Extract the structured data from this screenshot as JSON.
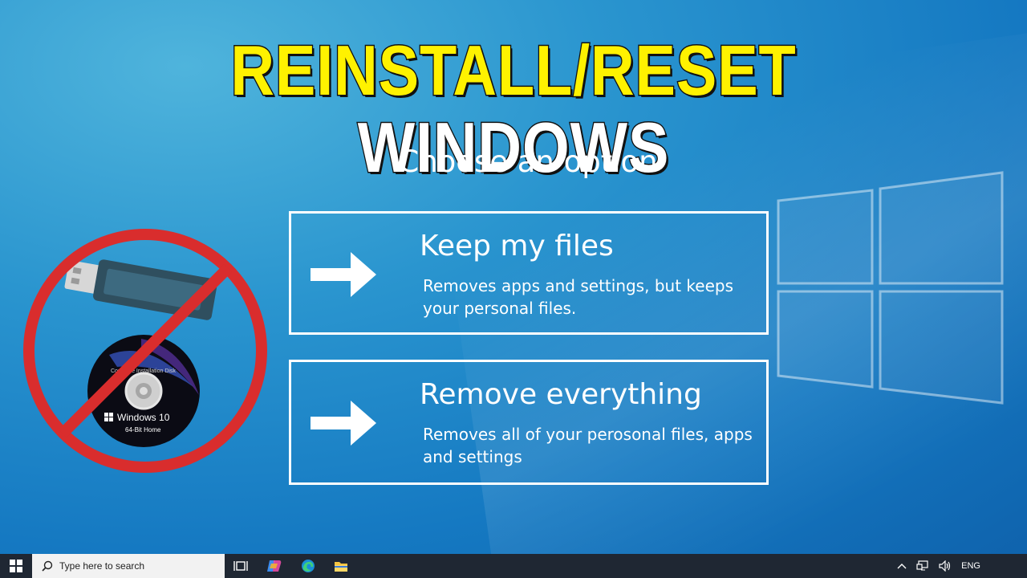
{
  "title": {
    "part1": "REINSTALL/RESET",
    "part2": "WINDOWS"
  },
  "heading": "Choose an option",
  "options": [
    {
      "title": "Keep my files",
      "description": "Removes apps and settings, but keeps your personal files.",
      "icon": "arrow-right-icon"
    },
    {
      "title": "Remove everything",
      "description": "Removes all of your perosonal files, apps and settings",
      "icon": "arrow-right-icon"
    }
  ],
  "disc": {
    "brand": "Windows 10",
    "edition": "64-Bit Home",
    "label": "Complete Installation Disk"
  },
  "taskbar": {
    "search_placeholder": "Type here to search",
    "language": "ENG",
    "icons": [
      "start-icon",
      "search-icon",
      "task-view-icon",
      "copilot-icon",
      "edge-icon",
      "file-explorer-icon"
    ]
  },
  "colors": {
    "title_yellow": "#fff200",
    "no_sign_red": "#d92d2d",
    "taskbar": "#1f2733"
  }
}
